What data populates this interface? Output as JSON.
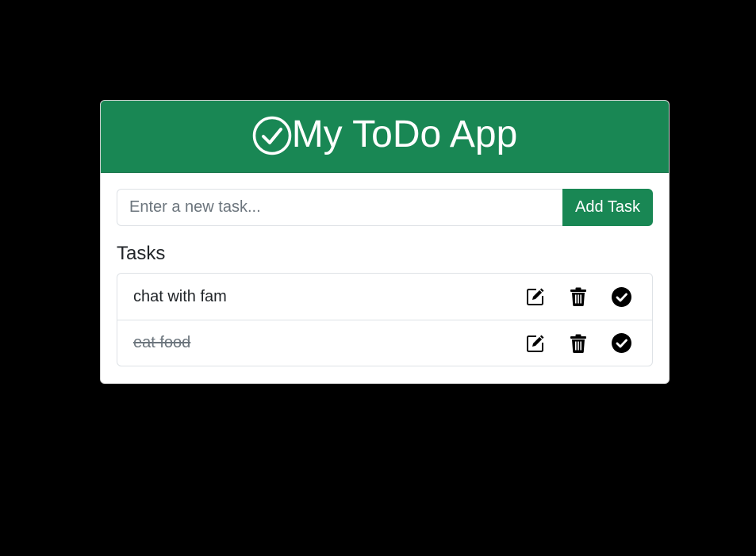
{
  "header": {
    "title": "My ToDo App",
    "icon": "check-circle-icon",
    "background_color": "#198754"
  },
  "new_task": {
    "placeholder": "Enter a new task...",
    "value": "",
    "add_label": "Add Task"
  },
  "tasks_section": {
    "title": "Tasks",
    "items": [
      {
        "text": "chat with fam",
        "completed": false,
        "icons": [
          "edit-icon",
          "trash-icon",
          "check-icon"
        ]
      },
      {
        "text": "eat food",
        "completed": true,
        "icons": [
          "edit-icon",
          "trash-icon",
          "check-icon"
        ]
      }
    ]
  }
}
